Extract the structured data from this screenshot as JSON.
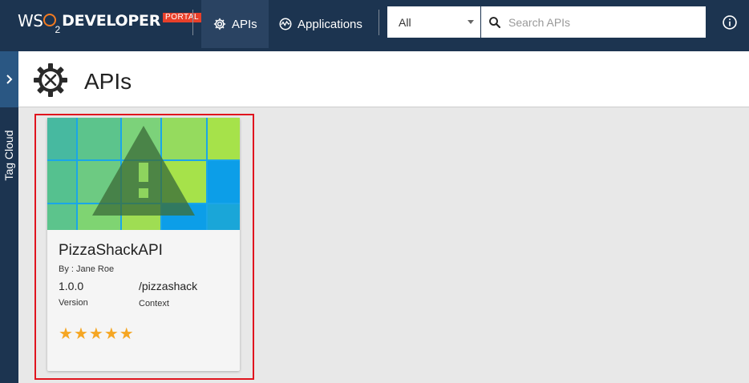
{
  "header": {
    "logo": {
      "wso": "WS",
      "two": "2",
      "developer": "DEVELOPER",
      "portal": "PORTAL"
    },
    "nav": [
      {
        "label": "APIs",
        "icon": "gear-icon",
        "active": true
      },
      {
        "label": "Applications",
        "icon": "applications-icon",
        "active": false
      }
    ],
    "filter": {
      "selected": "All"
    },
    "search": {
      "placeholder": "Search APIs",
      "value": ""
    },
    "info_icon": "info-icon"
  },
  "sidebar": {
    "tag_cloud_label": "Tag Cloud",
    "toggle_icon": "chevron-right-icon"
  },
  "page": {
    "title": "APIs",
    "icon": "api-gear-icon"
  },
  "cards": [
    {
      "name": "PizzaShackAPI",
      "by": "By : Jane Roe",
      "version": "1.0.0",
      "version_label": "Version",
      "context": "/pizzashack",
      "context_label": "Context",
      "rating": 5,
      "stars": "★★★★★"
    }
  ],
  "colors": {
    "topbar": "#1c3450",
    "accent": "#f47b20",
    "portal_badge": "#e8402a",
    "highlight": "#e0141e",
    "star": "#f5a623"
  }
}
